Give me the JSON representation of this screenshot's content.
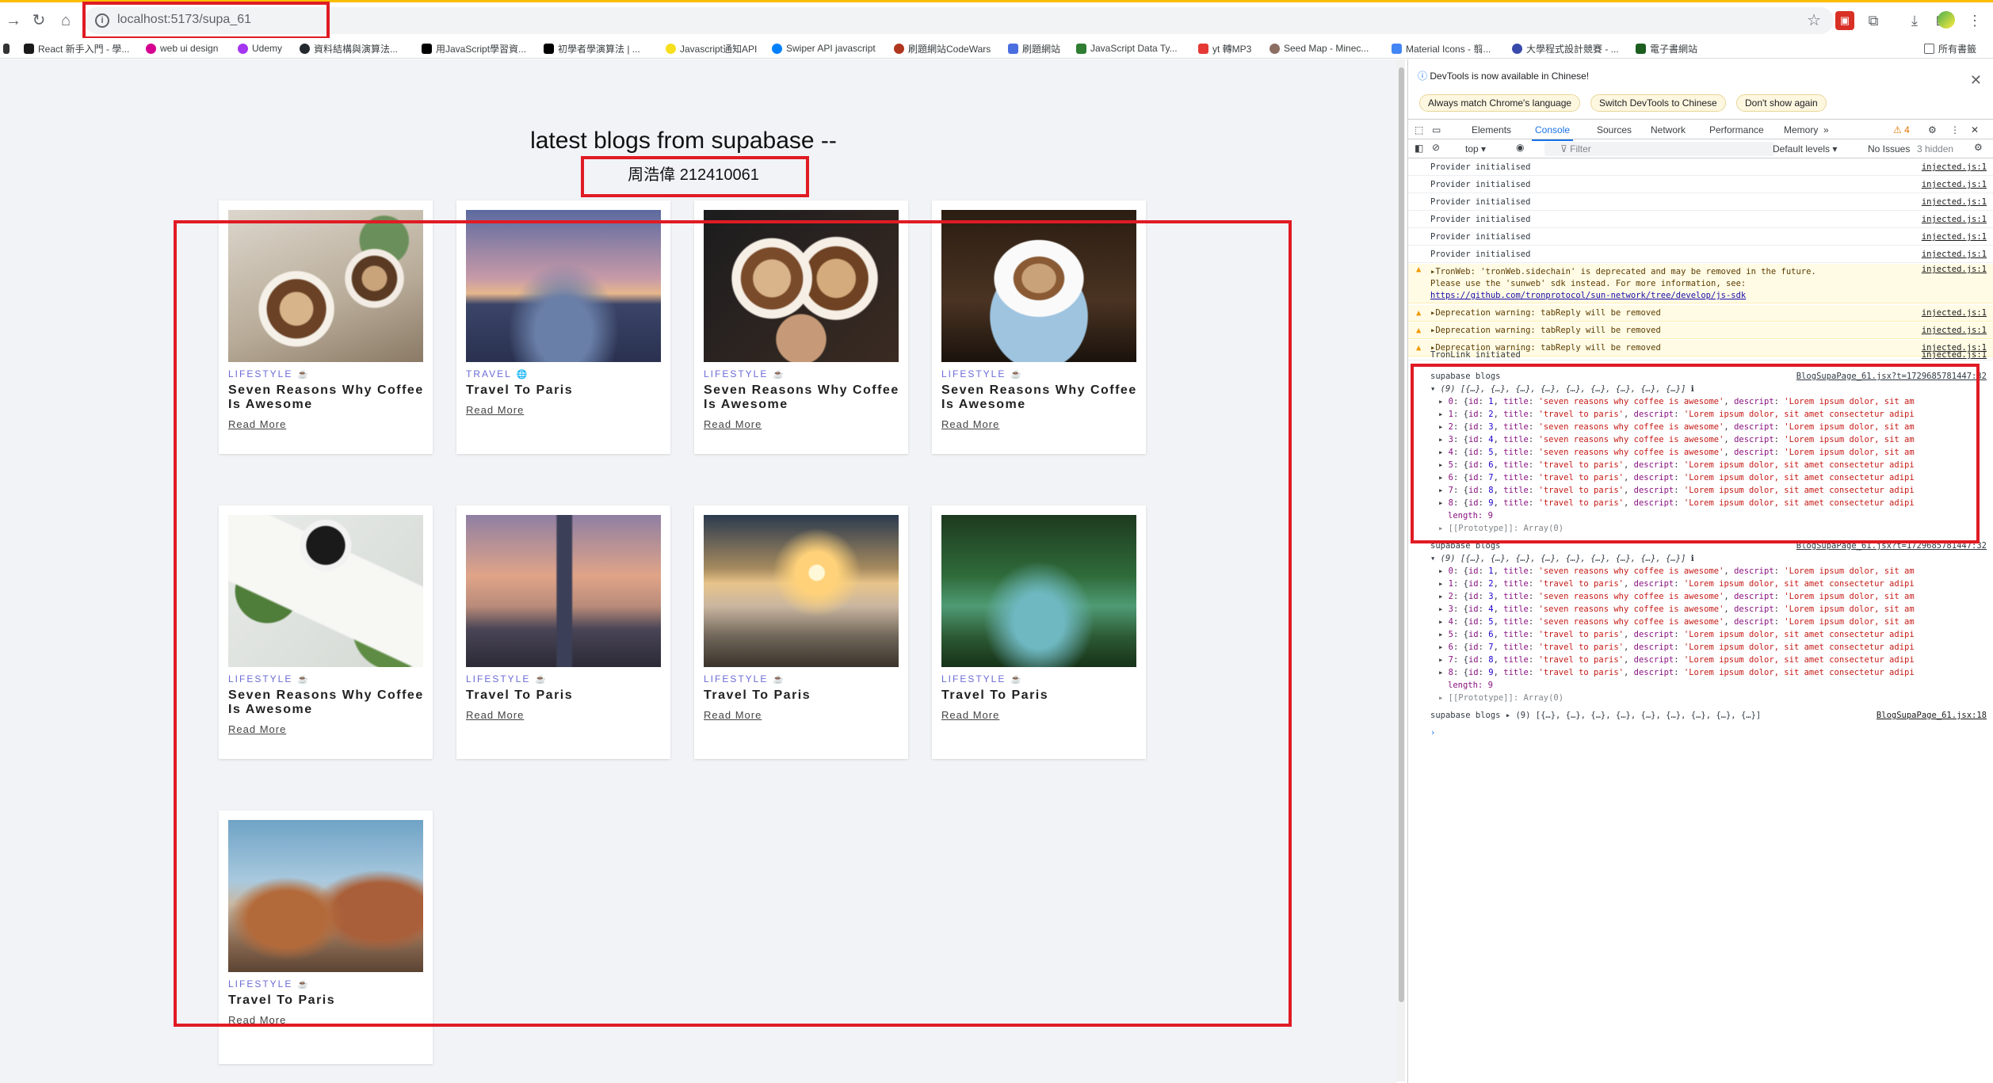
{
  "browser": {
    "url": "localhost:5173/supa_61",
    "bookmarks": [
      "React 新手入門 - 學...",
      "web ui design",
      "Udemy",
      "資料結構與演算法...",
      "用JavaScript學習資...",
      "初學者學演算法 | ...",
      "Javascript通知API",
      "Swiper API javascript",
      "刷題網站CodeWars",
      "刷題網站",
      "JavaScript Data Ty...",
      "yt 轉MP3",
      "Seed Map - Minec...",
      "Material Icons - 翦...",
      "大學程式設計競賽 - ...",
      "電子書網站",
      "所有書籤"
    ]
  },
  "page": {
    "title": "latest blogs from supabase --",
    "author": "周浩偉 212410061"
  },
  "cards": [
    {
      "category": "LIFESTYLE",
      "cat_icon": "☕",
      "title_line1": "Seven Reasons Why Coffee",
      "title_line2": "Is Awesome",
      "read_more": "Read More",
      "image": "coffee-latte"
    },
    {
      "category": "TRAVEL",
      "cat_icon": "🌐",
      "title_line1": "Travel To Paris",
      "title_line2": "",
      "read_more": "Read More",
      "image": "paris-bridge"
    },
    {
      "category": "LIFESTYLE",
      "cat_icon": "☕",
      "title_line1": "Seven Reasons Why Coffee",
      "title_line2": "Is Awesome",
      "read_more": "Read More",
      "image": "coffee-cheers"
    },
    {
      "category": "LIFESTYLE",
      "cat_icon": "☕",
      "title_line1": "Seven Reasons Why Coffee",
      "title_line2": "Is Awesome",
      "read_more": "Read More",
      "image": "coffee-cup"
    },
    {
      "category": "LIFESTYLE",
      "cat_icon": "☕",
      "title_line1": "Seven Reasons Why Coffee",
      "title_line2": "Is Awesome",
      "read_more": "Read More",
      "image": "coffee-note"
    },
    {
      "category": "LIFESTYLE",
      "cat_icon": "☕",
      "title_line1": "Travel To Paris",
      "title_line2": "",
      "read_more": "Read More",
      "image": "taipei-101"
    },
    {
      "category": "LIFESTYLE",
      "cat_icon": "☕",
      "title_line1": "Travel To Paris",
      "title_line2": "",
      "read_more": "Read More",
      "image": "sunrise-clouds"
    },
    {
      "category": "LIFESTYLE",
      "cat_icon": "☕",
      "title_line1": "Travel To Paris",
      "title_line2": "",
      "read_more": "Read More",
      "image": "green-river"
    },
    {
      "category": "LIFESTYLE",
      "cat_icon": "☕",
      "title_line1": "Travel To Paris",
      "title_line2": "",
      "read_more": "Read More",
      "image": "rock-formation"
    }
  ],
  "devtools": {
    "notice": "DevTools is now available in Chinese!",
    "btn_match": "Always match Chrome's language",
    "btn_switch": "Switch DevTools to Chinese",
    "btn_dont": "Don't show again",
    "tabs": [
      "Elements",
      "Console",
      "Sources",
      "Network",
      "Performance",
      "Memory"
    ],
    "warn_count": "4",
    "context": "top",
    "filter_placeholder": "Filter",
    "levels": "Default levels",
    "issues": "No Issues",
    "hidden": "3 hidden",
    "provider_lines": [
      "Provider initialised",
      "Provider initialised",
      "Provider initialised",
      "Provider initialised",
      "Provider initialised",
      "Provider initialised"
    ],
    "injected": "injected.js:1",
    "tronweb_1": "TronWeb: 'tronWeb.sidechain' is deprecated and may be removed in the future.",
    "tronweb_2": "Please use the 'sunweb' sdk instead. For more information, see:",
    "tronweb_3": "https://github.com/tronprotocol/sun-network/tree/develop/js-sdk",
    "deprecations": [
      "Deprecation warning: tabReply will be removed",
      "Deprecation warning: tabReply will be removed",
      "Deprecation warning: tabReply will be removed"
    ],
    "tronlink": "TronLink initiated",
    "group_label": "supabase blogs",
    "group_summary": "(9) [{…}, {…}, {…}, {…}, {…}, {…}, {…}, {…}, {…}]",
    "group_src": "BlogSupaPage_61.jsx?t=1729685781447:32",
    "items": [
      {
        "idx": "0",
        "id": "1",
        "title": "'seven reasons why coffee is awesome'",
        "desc": "'Lorem ipsum dolor, sit am"
      },
      {
        "idx": "1",
        "id": "2",
        "title": "'travel to paris'",
        "desc": "'Lorem ipsum dolor, sit amet consectetur adipi"
      },
      {
        "idx": "2",
        "id": "3",
        "title": "'seven reasons why coffee is awesome'",
        "desc": "'Lorem ipsum dolor, sit am"
      },
      {
        "idx": "3",
        "id": "4",
        "title": "'seven reasons why coffee is awesome'",
        "desc": "'Lorem ipsum dolor, sit am"
      },
      {
        "idx": "4",
        "id": "5",
        "title": "'seven reasons why coffee is awesome'",
        "desc": "'Lorem ipsum dolor, sit am"
      },
      {
        "idx": "5",
        "id": "6",
        "title": "'travel to paris'",
        "desc": "'Lorem ipsum dolor, sit amet consectetur adipi"
      },
      {
        "idx": "6",
        "id": "7",
        "title": "'travel to paris'",
        "desc": "'Lorem ipsum dolor, sit amet consectetur adipi"
      },
      {
        "idx": "7",
        "id": "8",
        "title": "'travel to paris'",
        "desc": "'Lorem ipsum dolor, sit amet consectetur adipi"
      },
      {
        "idx": "8",
        "id": "9",
        "title": "'travel to paris'",
        "desc": "'Lorem ipsum dolor, sit amet consectetur adipi"
      }
    ],
    "length_label": "length: 9",
    "prototype": "[[Prototype]]: Array(0)",
    "last_label": "supabase blogs",
    "last_summary": "(9) [{…}, {…}, {…}, {…}, {…}, {…}, {…}, {…}, {…}]",
    "last_src": "BlogSupaPage_61.jsx:18",
    "prompt": "›"
  }
}
